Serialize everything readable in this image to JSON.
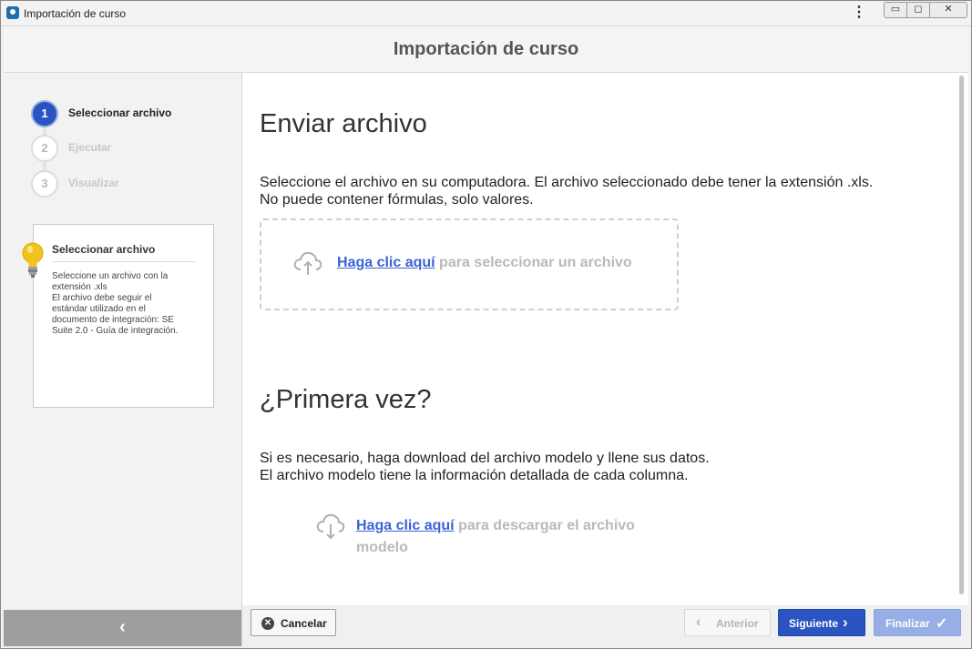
{
  "window": {
    "title": "Importación de curso",
    "controls": {
      "minimize": "▭",
      "maximize": "◻",
      "close": "✕"
    },
    "menu_icon": "⋮"
  },
  "header": {
    "title": "Importación de curso"
  },
  "steps": [
    {
      "number": "1",
      "label": "Seleccionar archivo",
      "state": "active"
    },
    {
      "number": "2",
      "label": "Ejecutar",
      "state": "inactive"
    },
    {
      "number": "3",
      "label": "Visualizar",
      "state": "inactive"
    }
  ],
  "info_box": {
    "icon": "lightbulb-icon",
    "title": "Seleccionar archivo",
    "lines": [
      "Seleccione un archivo con la",
      "extensión .xls",
      "El archivo debe seguir el",
      "estándar utilizado en el",
      "documento de integración: SE",
      "Suite 2.0 - Guía de integración."
    ]
  },
  "sidebar": {
    "collapse_icon": "‹"
  },
  "upload_section": {
    "title": "Enviar archivo",
    "description_line1": "Seleccione el archivo en su computadora. El archivo seleccionado debe tener la extensión .xls.",
    "description_line2": "No puede contener fórmulas, solo valores.",
    "link_text": "Haga clic aquí",
    "rest_text": "para seleccionar un archivo",
    "icon": "cloud-upload-icon"
  },
  "first_time_section": {
    "title": "¿Primera vez?",
    "description_line1": "Si es necesario, haga download del archivo modelo y llene sus datos.",
    "description_line2": "El archivo modelo tiene la información detallada de cada columna.",
    "link_text": "Haga clic aquí",
    "rest_text": "para descargar el archivo modelo",
    "icon": "cloud-download-icon"
  },
  "footer": {
    "cancel_label": "Cancelar",
    "previous_label": "Anterior",
    "next_label": "Siguiente",
    "finish_label": "Finalizar"
  },
  "colors": {
    "primary": "#2a54c2",
    "primary_disabled": "#97aee6",
    "link": "#3a63d4",
    "muted_text": "#b9b9b9"
  }
}
